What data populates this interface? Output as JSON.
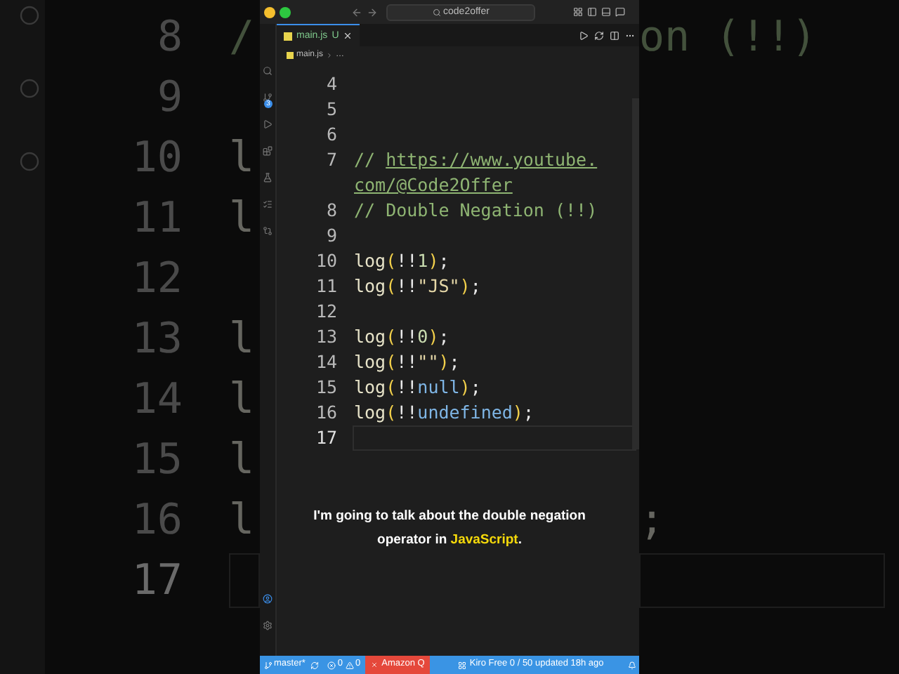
{
  "background": {
    "lines": [
      {
        "number": "8",
        "left": "/",
        "right": "on (!!)",
        "kind": "comment",
        "current": false
      },
      {
        "number": "9",
        "current": false
      },
      {
        "number": "10",
        "left": "l",
        "kind": "code",
        "current": false
      },
      {
        "number": "11",
        "left": "l",
        "kind": "code",
        "current": false
      },
      {
        "number": "12",
        "current": false
      },
      {
        "number": "13",
        "left": "l",
        "kind": "code",
        "current": false
      },
      {
        "number": "14",
        "left": "l",
        "kind": "code",
        "current": false
      },
      {
        "number": "15",
        "left": "l",
        "kind": "code",
        "current": false
      },
      {
        "number": "16",
        "left": "l",
        "right": ";",
        "kind": "code",
        "current": false
      },
      {
        "number": "17",
        "current": true
      }
    ]
  },
  "window": {
    "search": "code2offer"
  },
  "tab": {
    "label": "main.js",
    "status": "U",
    "selected": true
  },
  "breadcrumb": [
    "main.js",
    "…"
  ],
  "activity_bar": {
    "badge": "3"
  },
  "editor": {
    "lines": [
      {
        "number": "4",
        "current": false
      },
      {
        "number": "5",
        "current": false
      },
      {
        "number": "6",
        "current": false
      },
      {
        "number": "7",
        "current": false,
        "tokens": [
          {
            "kind": "comment",
            "text": "// "
          },
          {
            "kind": "link",
            "text": "https://www.youtube."
          },
          {
            "kind": "break"
          },
          {
            "kind": "link",
            "text": "com/@Code2Offer"
          }
        ]
      },
      {
        "number": "8",
        "current": false,
        "tokens": [
          {
            "kind": "comment",
            "text": "// Double Negation (!!)"
          }
        ]
      },
      {
        "number": "9",
        "current": false
      },
      {
        "number": "10",
        "current": false,
        "tokens": [
          {
            "kind": "func",
            "text": "log"
          },
          {
            "kind": "paren",
            "text": "("
          },
          {
            "kind": "op",
            "text": "!!"
          },
          {
            "kind": "number",
            "text": "1"
          },
          {
            "kind": "paren",
            "text": ")"
          },
          {
            "kind": "punct",
            "text": ";"
          }
        ]
      },
      {
        "number": "11",
        "current": false,
        "tokens": [
          {
            "kind": "func",
            "text": "log"
          },
          {
            "kind": "paren",
            "text": "("
          },
          {
            "kind": "op",
            "text": "!!"
          },
          {
            "kind": "string",
            "text": "\"JS\""
          },
          {
            "kind": "paren",
            "text": ")"
          },
          {
            "kind": "punct",
            "text": ";"
          }
        ]
      },
      {
        "number": "12",
        "current": false
      },
      {
        "number": "13",
        "current": false,
        "tokens": [
          {
            "kind": "func",
            "text": "log"
          },
          {
            "kind": "paren",
            "text": "("
          },
          {
            "kind": "op",
            "text": "!!"
          },
          {
            "kind": "number",
            "text": "0"
          },
          {
            "kind": "paren",
            "text": ")"
          },
          {
            "kind": "punct",
            "text": ";"
          }
        ]
      },
      {
        "number": "14",
        "current": false,
        "tokens": [
          {
            "kind": "func",
            "text": "log"
          },
          {
            "kind": "paren",
            "text": "("
          },
          {
            "kind": "op",
            "text": "!!"
          },
          {
            "kind": "string",
            "text": "\"\""
          },
          {
            "kind": "paren",
            "text": ")"
          },
          {
            "kind": "punct",
            "text": ";"
          }
        ]
      },
      {
        "number": "15",
        "current": false,
        "tokens": [
          {
            "kind": "func",
            "text": "log"
          },
          {
            "kind": "paren",
            "text": "("
          },
          {
            "kind": "op",
            "text": "!!"
          },
          {
            "kind": "constant",
            "text": "null"
          },
          {
            "kind": "paren",
            "text": ")"
          },
          {
            "kind": "punct",
            "text": ";"
          }
        ]
      },
      {
        "number": "16",
        "current": false,
        "tokens": [
          {
            "kind": "func",
            "text": "log"
          },
          {
            "kind": "paren",
            "text": "("
          },
          {
            "kind": "op",
            "text": "!!"
          },
          {
            "kind": "constant",
            "text": "undefined"
          },
          {
            "kind": "paren",
            "text": ")"
          },
          {
            "kind": "punct",
            "text": ";"
          }
        ]
      },
      {
        "number": "17",
        "current": true
      }
    ]
  },
  "caption": {
    "parts": [
      {
        "text": "I'm going to talk about the double negation operator in ",
        "highlight": false
      },
      {
        "text": "JavaScript",
        "highlight": true
      },
      {
        "text": ".",
        "highlight": false
      }
    ]
  },
  "status_bar": {
    "branch": "master*",
    "errors": "0",
    "warnings": "0",
    "amazon_q": "Amazon Q",
    "kiro": "Kiro Free 0 / 50 updated 18h ago"
  }
}
